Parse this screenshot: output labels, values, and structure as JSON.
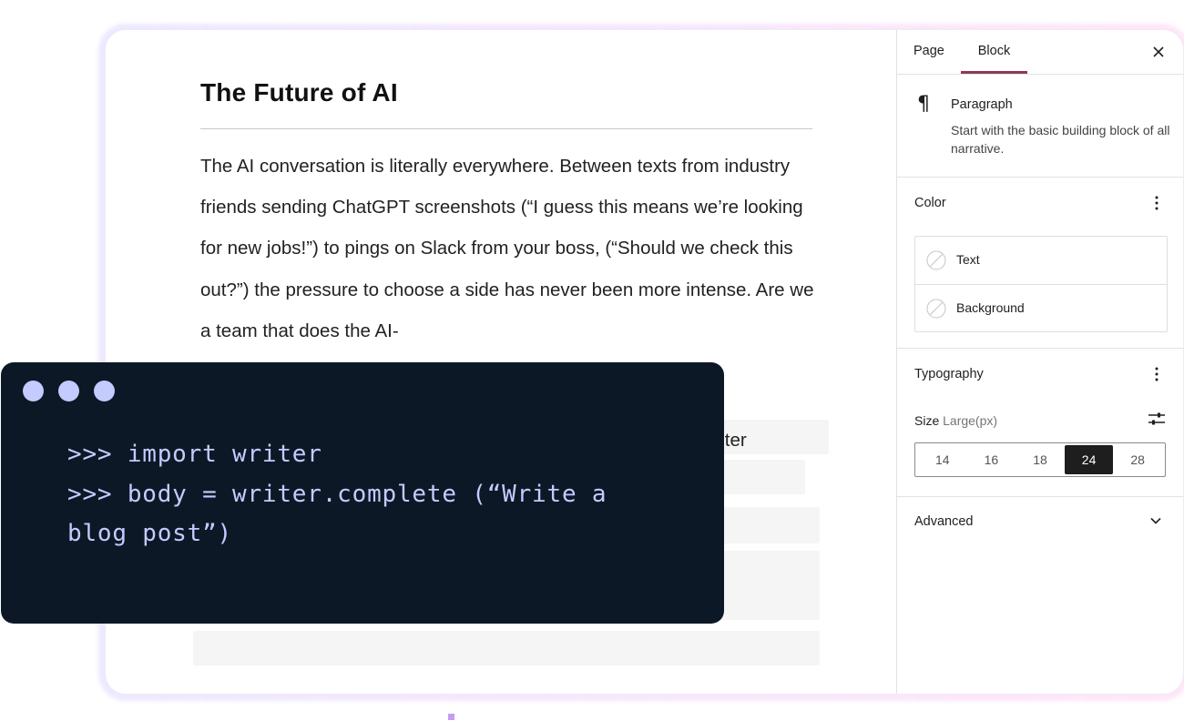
{
  "editor": {
    "title": "The Future of AI",
    "body": "The AI conversation is literally everywhere. Between texts from industry friends sending ChatGPT screenshots (“I guess this means we’re looking for new jobs!”) to pings on Slack from your boss, (“Should we check this out?”) the pressure to choose a side has never been more intense. Are we a team that does the AI-",
    "body_fragment": "onter"
  },
  "sidebar": {
    "tabs": [
      {
        "label": "Page",
        "active": false
      },
      {
        "label": "Block",
        "active": true
      }
    ],
    "close_icon": "close-icon",
    "block": {
      "icon": "paragraph-icon",
      "name": "Paragraph",
      "description": "Start with the basic building block of all narrative."
    },
    "color": {
      "title": "Color",
      "items": [
        {
          "label": "Text"
        },
        {
          "label": "Background"
        }
      ]
    },
    "typography": {
      "title": "Typography",
      "size_label": "Size",
      "size_value": "Large(px)",
      "sizes": [
        "14",
        "16",
        "18",
        "24",
        "28"
      ],
      "selected_size": "24"
    },
    "advanced": {
      "title": "Advanced"
    }
  },
  "code_window": {
    "line1": ">>> import writer",
    "line2": ">>> body = writer.complete (“Write a",
    "line3": "blog post”)"
  },
  "colors": {
    "accent_tab": "#8e3a57",
    "code_bg": "#0d1827",
    "code_text": "#c4cbff",
    "selected_size_bg": "#1e1e1e"
  }
}
